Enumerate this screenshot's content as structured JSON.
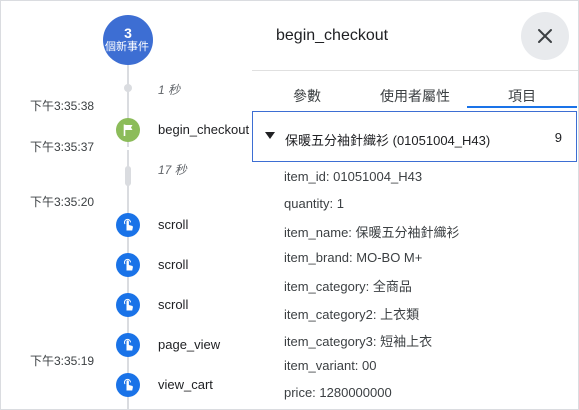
{
  "timeline": {
    "count_bubble": {
      "number": "3",
      "label": "個新事件"
    },
    "timestamps": [
      "下午3:35:38",
      "下午3:35:37",
      "下午3:35:20",
      "下午3:35:19"
    ],
    "gaps": [
      "1 秒",
      "17 秒"
    ],
    "events": [
      {
        "name": "begin_checkout",
        "icon": "flag-icon"
      },
      {
        "name": "scroll",
        "icon": "touch-icon"
      },
      {
        "name": "scroll",
        "icon": "touch-icon"
      },
      {
        "name": "scroll",
        "icon": "touch-icon"
      },
      {
        "name": "page_view",
        "icon": "touch-icon"
      },
      {
        "name": "view_cart",
        "icon": "touch-icon"
      }
    ]
  },
  "panel": {
    "title": "begin_checkout",
    "tabs": [
      {
        "label": "參數"
      },
      {
        "label": "使用者屬性"
      },
      {
        "label": "項目",
        "active": true
      }
    ],
    "item": {
      "name": "保暖五分袖針織衫 (01051004_H43)",
      "quantity": "9"
    },
    "params": [
      "item_id: 01051004_H43",
      "quantity: 1",
      "item_name: 保暖五分袖針織衫",
      "item_brand: MO-BO M+",
      "item_category: 全商品",
      "item_category2: 上衣類",
      "item_category3: 短袖上衣",
      "item_variant: 00",
      "price: 1280000000"
    ]
  },
  "colors": {
    "accent": "#1a73e8",
    "bubble": "#3d6ed3",
    "flag_green": "#8cbc5a",
    "line_grey": "#dadce0"
  }
}
